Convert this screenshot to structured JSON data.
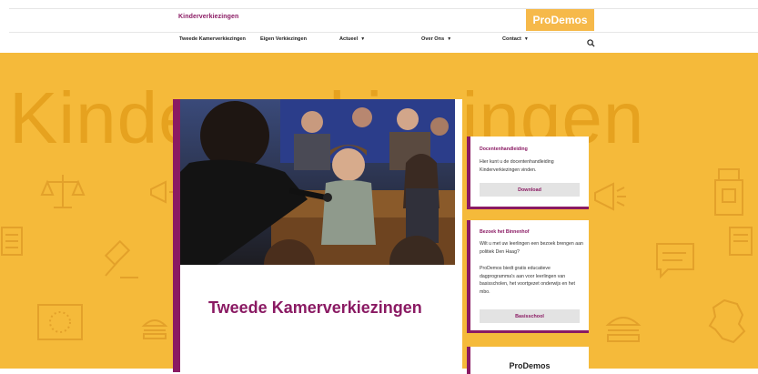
{
  "header": {
    "site_title": "Kinderverkiezingen",
    "logo": "ProDemos"
  },
  "nav": {
    "items": [
      {
        "label": "Tweede Kamerverkiezingen",
        "has_dropdown": false
      },
      {
        "label": "Eigen Verkiezingen",
        "has_dropdown": false
      },
      {
        "label": "Actueel",
        "has_dropdown": true
      },
      {
        "label": "Over Ons",
        "has_dropdown": true
      },
      {
        "label": "Contact",
        "has_dropdown": true
      }
    ],
    "search_icon": "search-icon"
  },
  "hero": {
    "watermark_text": "Kinderverkiezingen",
    "background_color": "#f5ba3a",
    "accent_color": "#8a1a63"
  },
  "main_card": {
    "title": "Tweede Kamerverkiezingen",
    "image": "students-in-parliament-photo"
  },
  "side_cards": [
    {
      "heading": "Docentenhandleiding",
      "paragraphs": [
        "Hier kunt u de docentenhandleiding Kinderverkiezingen vinden."
      ],
      "button": "Download"
    },
    {
      "heading": "Bezoek het Binnenhof",
      "paragraphs": [
        "Wilt u met uw leerlingen een bezoek brengen aan politiek Den Haag?",
        "ProDemos biedt gratis educatieve dagprogramma's aan voor leerlingen van basisscholen, het voortgezet onderwijs en het mbo."
      ],
      "button": "Basisschool"
    },
    {
      "heading": "ProDemos"
    }
  ]
}
